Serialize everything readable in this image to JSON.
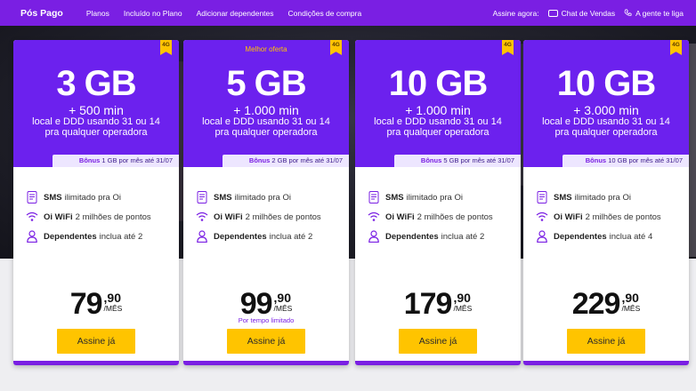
{
  "header": {
    "brand": "Pós Pago",
    "nav": [
      "Planos",
      "Incluído no Plano",
      "Adicionar dependentes",
      "Condições de compra"
    ],
    "assine_agora": "Assine agora:",
    "chat": "Chat de Vendas",
    "call": "A gente te liga"
  },
  "colors": {
    "purple": "#6c21ee",
    "yellow": "#ffc400",
    "topbar": "#7a1fe3"
  },
  "plans": [
    {
      "badge": "4G",
      "offer": "",
      "gb": "3 GB",
      "mins": "+ 500 min",
      "desc1": "local e DDD usando 31 ou 14",
      "desc2": "pra qualquer operadora",
      "bonus_label": "Bônus",
      "bonus_text": "1 GB por mês até 31/07",
      "sms_b": "SMS",
      "sms": "ilimitado pra Oi",
      "wifi_b": "Oi WiFi",
      "wifi": "2 milhões de pontos",
      "dep_b": "Dependentes",
      "dep": "inclua até 2",
      "price_int": "79",
      "price_cents": ",90",
      "price_unit": "/MÊS",
      "note": "",
      "cta": "Assine já"
    },
    {
      "badge": "4G",
      "offer": "Melhor oferta",
      "gb": "5 GB",
      "mins": "+ 1.000 min",
      "desc1": "local e DDD usando 31 ou 14",
      "desc2": "pra qualquer operadora",
      "bonus_label": "Bônus",
      "bonus_text": "2 GB por mês até 31/07",
      "sms_b": "SMS",
      "sms": "ilimitado pra Oi",
      "wifi_b": "Oi WiFi",
      "wifi": "2 milhões de pontos",
      "dep_b": "Dependentes",
      "dep": "inclua até 2",
      "price_int": "99",
      "price_cents": ",90",
      "price_unit": "/MÊS",
      "note": "Por tempo limitado",
      "cta": "Assine já"
    },
    {
      "badge": "4G",
      "offer": "",
      "gb": "10 GB",
      "mins": "+ 1.000 min",
      "desc1": "local e DDD usando 31 ou 14",
      "desc2": "pra qualquer operadora",
      "bonus_label": "Bônus",
      "bonus_text": "5 GB por mês até 31/07",
      "sms_b": "SMS",
      "sms": "ilimitado pra Oi",
      "wifi_b": "Oi WiFi",
      "wifi": "2 milhões de pontos",
      "dep_b": "Dependentes",
      "dep": "inclua até 2",
      "price_int": "179",
      "price_cents": ",90",
      "price_unit": "/MÊS",
      "note": "",
      "cta": "Assine já"
    },
    {
      "badge": "4G",
      "offer": "",
      "gb": "10 GB",
      "mins": "+ 3.000 min",
      "desc1": "local e DDD usando 31 ou 14",
      "desc2": "pra qualquer operadora",
      "bonus_label": "Bônus",
      "bonus_text": "10 GB por mês até 31/07",
      "sms_b": "SMS",
      "sms": "ilimitado pra Oi",
      "wifi_b": "Oi WiFi",
      "wifi": "2 milhões de pontos",
      "dep_b": "Dependentes",
      "dep": "inclua até 4",
      "price_int": "229",
      "price_cents": ",90",
      "price_unit": "/MÊS",
      "note": "",
      "cta": "Assine já"
    }
  ]
}
